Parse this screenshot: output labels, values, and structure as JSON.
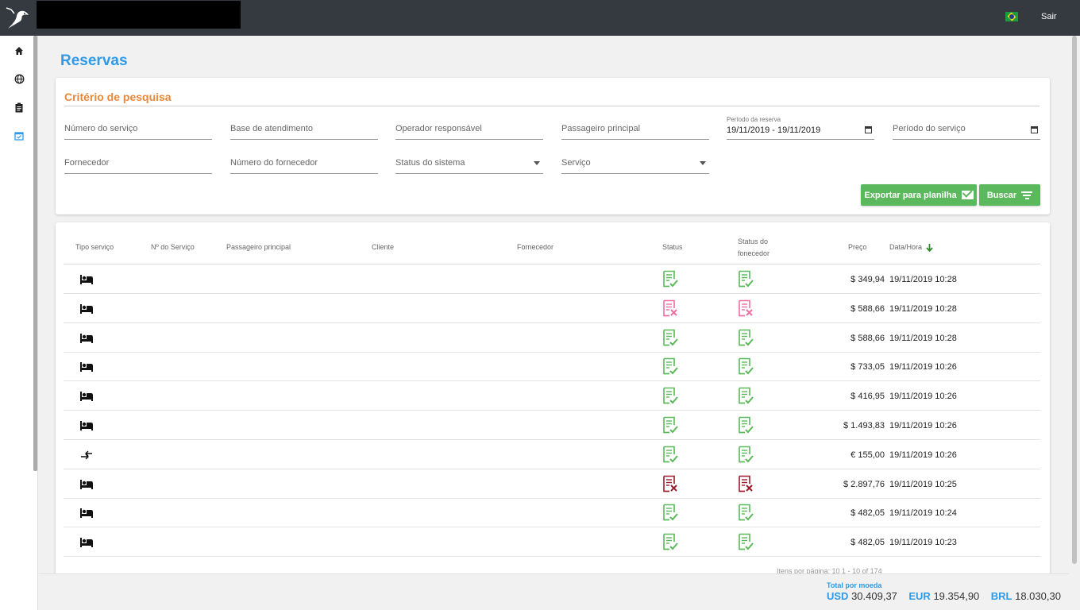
{
  "header": {
    "logout_label": "Sair",
    "language_flag": "brazil-flag"
  },
  "page": {
    "title": "Reservas"
  },
  "search": {
    "title": "Critério de pesquisa",
    "fields": {
      "service_number": "Número do serviço",
      "service_base": "Base de atendimento",
      "operator": "Operador responsável",
      "main_passenger": "Passageiro principal",
      "booking_period_label": "Período da reserva",
      "booking_period_value": "19/11/2019 - 19/11/2019",
      "service_period": "Período do serviço",
      "supplier": "Fornecedor",
      "supplier_number": "Número do fornecedor",
      "system_status": "Status do sistema",
      "service": "Serviço"
    },
    "export_label": "Exportar para planilha",
    "search_label": "Buscar"
  },
  "table": {
    "headers": {
      "service_type": "Tipo serviço",
      "service_number": "Nº do Serviço",
      "main_passenger": "Passageiro principal",
      "client": "Cliente",
      "supplier": "Fornecedor",
      "status": "Status",
      "supplier_status_1": "Status do",
      "supplier_status_2": "fonecedor",
      "price": "Preço",
      "datetime": "Data/Hora"
    },
    "rows": [
      {
        "type": "hotel",
        "status": "ok",
        "supplier_status": "ok",
        "price": "$ 349,94",
        "date": "19/11/2019 10:28"
      },
      {
        "type": "hotel",
        "status": "cancelled",
        "supplier_status": "cancelled",
        "price": "$ 588,66",
        "date": "19/11/2019 10:28"
      },
      {
        "type": "hotel",
        "status": "ok",
        "supplier_status": "ok",
        "price": "$ 588,66",
        "date": "19/11/2019 10:28"
      },
      {
        "type": "hotel",
        "status": "ok",
        "supplier_status": "ok",
        "price": "$ 733,05",
        "date": "19/11/2019 10:26"
      },
      {
        "type": "hotel",
        "status": "ok",
        "supplier_status": "ok",
        "price": "$ 416,95",
        "date": "19/11/2019 10:26"
      },
      {
        "type": "hotel",
        "status": "ok",
        "supplier_status": "ok",
        "price": "$ 1.493,83",
        "date": "19/11/2019 10:26"
      },
      {
        "type": "transfer",
        "status": "ok",
        "supplier_status": "ok",
        "price": "€ 155,00",
        "date": "19/11/2019 10:26"
      },
      {
        "type": "hotel",
        "status": "error",
        "supplier_status": "error",
        "price": "$ 2.897,76",
        "date": "19/11/2019 10:25"
      },
      {
        "type": "hotel",
        "status": "ok",
        "supplier_status": "ok",
        "price": "$ 482,05",
        "date": "19/11/2019 10:24"
      },
      {
        "type": "hotel",
        "status": "ok",
        "supplier_status": "ok",
        "price": "$ 482,05",
        "date": "19/11/2019 10:23"
      }
    ],
    "pager_text": "Itens por página: 10        1 - 10 of 174"
  },
  "footer": {
    "label": "Total por moeda",
    "totals": [
      {
        "currency": "USD",
        "value": "30.409,37"
      },
      {
        "currency": "EUR",
        "value": "19.354,90"
      },
      {
        "currency": "BRL",
        "value": "18.030,30"
      }
    ]
  },
  "colors": {
    "accent_blue": "#2f9ae8",
    "accent_orange": "#e8883a",
    "button_green": "#5cb85c",
    "status_ok": "#5cb85c",
    "status_cancelled": "#f06fa0",
    "status_error": "#9b1c2a"
  }
}
